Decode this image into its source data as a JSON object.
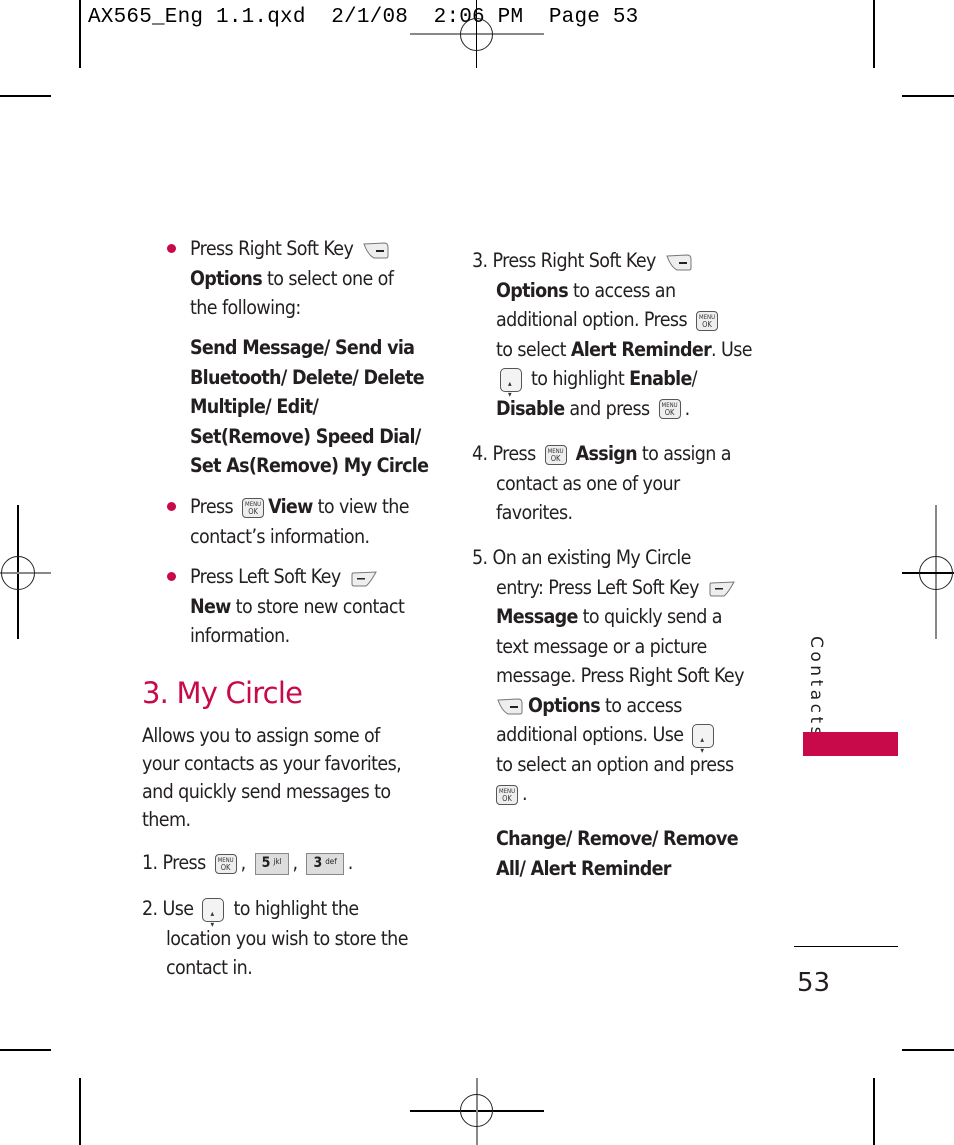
{
  "slug": {
    "text": "AX565_Eng 1.1.qxd  2/1/08  2:06 PM  Page 53"
  },
  "left_column": {
    "bullets": [
      {
        "parts": [
          {
            "t": "Press Right Soft Key "
          },
          {
            "icon": "right-soft-key-icon"
          },
          {
            "b": "Options"
          },
          {
            "t": " to select one of the following:"
          }
        ],
        "lines": [
          "Press Right Soft Key",
          "to select one of",
          "the following:"
        ],
        "bold_options": "Options"
      }
    ],
    "bullet1": {
      "line1": "Press Right Soft Key",
      "bold": "Options",
      "rest1": " to select one of",
      "line3": "the following:"
    },
    "options_list": {
      "line1": "Send Message/ Send via",
      "line2": "Bluetooth/ Delete/ Delete",
      "line3": "Multiple/ Edit/",
      "line4": "Set(Remove) Speed Dial/",
      "line5": "Set As(Remove) My Circle"
    },
    "bullet2": {
      "press": "Press",
      "bold": "View",
      "rest1": " to view the",
      "line2": "contact’s information."
    },
    "bullet3": {
      "line1": "Press Left Soft Key",
      "bold": "New",
      "rest1": " to store new contact",
      "line3": "information."
    },
    "section_heading": "3. My Circle",
    "intro": {
      "line1": "Allows you to assign some of",
      "line2": "your contacts as your favorites,",
      "line3": "and quickly send messages to",
      "line4": "them."
    },
    "step1": {
      "num": "1.",
      "press": "Press",
      "sep1": ",",
      "key1_digit": "5",
      "key1_letters": "jkl",
      "sep2": ",",
      "key2_digit": "3",
      "key2_letters": "def",
      "end": "."
    },
    "step2": {
      "num": "2.",
      "use": "Use",
      "rest1": "to highlight the",
      "line2": "location you wish to store the",
      "line3": "contact in."
    }
  },
  "right_column": {
    "step3": {
      "num": "3.",
      "line1": "Press Right Soft Key",
      "bold1": "Options",
      "rest2": " to access an",
      "line3": "additional option. Press",
      "pre4": "to select ",
      "bold4": "Alert Reminder",
      "post4": ". Use",
      "pre5": "to highlight ",
      "bold5": "Enable",
      "post5": "/",
      "bold6": "Disable",
      "post6": " and press",
      "end6": "."
    },
    "step4": {
      "num": "4.",
      "press": "Press",
      "bold": "Assign",
      "rest1": " to assign a",
      "line2": "contact as one of your",
      "line3": "favorites."
    },
    "step5": {
      "num": "5.",
      "line1": "On an existing My Circle",
      "line2": "entry: Press Left Soft Key",
      "bold3": "Message",
      "rest3": " to quickly send a",
      "line4": "text message or a picture",
      "line5": "message. Press Right Soft Key",
      "bold6": "Options",
      "rest6": " to access",
      "line7": "additional options. Use",
      "line8": "to select an option and press",
      "end9": "."
    },
    "options_list": {
      "line1": "Change/ Remove/ Remove",
      "line2": "All/ Alert Reminder"
    }
  },
  "keys": {
    "menu_top": "MENU",
    "menu_bottom": "OK"
  },
  "side_tab": {
    "label": "Contacts",
    "color": "#c8094a"
  },
  "page_number": "53",
  "colors": {
    "accent": "#c8094a",
    "text": "#231f20"
  }
}
